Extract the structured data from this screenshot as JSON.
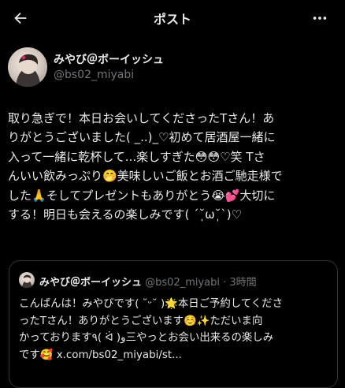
{
  "header": {
    "title": "ポスト",
    "back_icon": "arrow-left-icon",
    "more_icon": "more-horizontal-icon"
  },
  "author": {
    "name": "みやび＠ボーイッシュ",
    "handle": "@bs02_miyabi"
  },
  "post": {
    "lines": [
      "取り急ぎで！本日お会いしてくださったTさん！あ",
      "りがとうございました( _..)_♡初めて居酒屋一緒に",
      "入って一緒に乾杯して...楽しすぎた😳😳♡笑 Tさ",
      "んいい飲みっぷり🤭美味しいご飯とお酒ご馳走様で",
      "した🙏そしてプレゼントもありがとう😭💕大切に",
      "する！明日も会えるの楽しみです( ´˘̩ω˘̩`)♡"
    ]
  },
  "quote": {
    "name": "みやび＠ボーイッシュ",
    "meta": " @bs02_miyabi · 3時間",
    "lines": [
      "こんばんは！みやびです( ˘ᵕ˘ )🌟本日ご予約してくださ",
      "ったTさん！ありがとうございます☺️✨ただいま向",
      "かっております٩( ᐛ )و三やっとお会い出来るの楽しみ",
      "です🥰 x.com/bs02_miyabi/st..."
    ]
  },
  "colors": {
    "background": "#000000",
    "text": "#e7e9ea",
    "muted": "#71767b",
    "border": "#2f3336"
  }
}
